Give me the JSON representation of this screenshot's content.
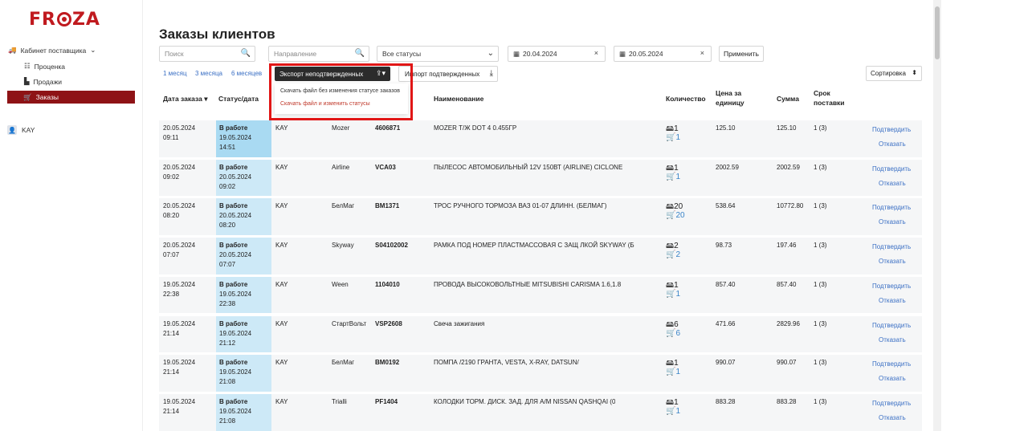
{
  "logo": "FROZA",
  "sidebar": {
    "cabinet_label": "Кабинет поставщика",
    "items": [
      {
        "label": "Проценка"
      },
      {
        "label": "Продажи"
      },
      {
        "label": "Заказы"
      }
    ],
    "user": "KAY"
  },
  "page": {
    "title": "Заказы клиентов"
  },
  "filters": {
    "search_placeholder": "Поиск",
    "direction_placeholder": "Направление",
    "status_value": "Все статусы",
    "date_from": "20.04.2024",
    "date_to": "20.05.2024",
    "apply_label": "Применить"
  },
  "periods": [
    "1 месяц",
    "3 месяца",
    "6 месяцев"
  ],
  "export_label": "Экспорт неподтвержденных",
  "import_label": "Импорт подтвержденных",
  "export_menu": {
    "item1": "Скачать файл без изменения статусе заказов",
    "item2": "Скачать файл и изменить статусы"
  },
  "sort_label": "Сортировка",
  "table": {
    "headers": {
      "date": "Дата заказа",
      "status": "Статус/дата",
      "name": "Наименование",
      "qty": "Количество",
      "price": "Цена за единицу",
      "sum": "Сумма",
      "term": "Срок поставки"
    },
    "confirm_label": "Подтвердить",
    "reject_label": "Отказать",
    "rows": [
      {
        "date": "20.05.2024",
        "time": "09:11",
        "status": "В работе",
        "sdate": "19.05.2024",
        "stime": "14:51",
        "client": "KAY",
        "brand": "Mozer",
        "article": "4606871",
        "name": "MOZER Т/Ж DOT 4 0.455ГР",
        "qty": "1",
        "qty2": "1",
        "price": "125.10",
        "sum": "125.10",
        "term": "1 (3)"
      },
      {
        "date": "20.05.2024",
        "time": "09:02",
        "status": "В работе",
        "sdate": "20.05.2024",
        "stime": "09:02",
        "client": "KAY",
        "brand": "Airline",
        "article": "VCA03",
        "name": "ПЫЛЕСОС АВТОМОБИЛЬНЫЙ 12V 150ВТ (AIRLINE) CICLONE",
        "qty": "1",
        "qty2": "1",
        "price": "2002.59",
        "sum": "2002.59",
        "term": "1 (3)"
      },
      {
        "date": "20.05.2024",
        "time": "08:20",
        "status": "В работе",
        "sdate": "20.05.2024",
        "stime": "08:20",
        "client": "KAY",
        "brand": "БелМаг",
        "article": "BM1371",
        "name": "ТРОС РУЧНОГО ТОРМОЗА ВАЗ 01-07 ДЛИНН. (БЕЛМАГ)",
        "qty": "20",
        "qty2": "20",
        "price": "538.64",
        "sum": "10772.80",
        "term": "1 (3)"
      },
      {
        "date": "20.05.2024",
        "time": "07:07",
        "status": "В работе",
        "sdate": "20.05.2024",
        "stime": "07:07",
        "client": "KAY",
        "brand": "Skyway",
        "article": "S04102002",
        "name": "РАМКА ПОД НОМЕР ПЛАСТМАССОВАЯ С ЗАЩ ЛКОЙ SKYWAY (Б",
        "qty": "2",
        "qty2": "2",
        "price": "98.73",
        "sum": "197.46",
        "term": "1 (3)"
      },
      {
        "date": "19.05.2024",
        "time": "22:38",
        "status": "В работе",
        "sdate": "19.05.2024",
        "stime": "22:38",
        "client": "KAY",
        "brand": "Ween",
        "article": "1104010",
        "name": "ПРОВОДА ВЫСОКОВОЛЬТНЫЕ MITSUBISHI CARISMA 1.6,1.8",
        "qty": "1",
        "qty2": "1",
        "price": "857.40",
        "sum": "857.40",
        "term": "1 (3)"
      },
      {
        "date": "19.05.2024",
        "time": "21:14",
        "status": "В работе",
        "sdate": "19.05.2024",
        "stime": "21:12",
        "client": "KAY",
        "brand": "СтартВольт",
        "article": "VSP2608",
        "name": "Свеча зажигания",
        "qty": "6",
        "qty2": "6",
        "price": "471.66",
        "sum": "2829.96",
        "term": "1 (3)"
      },
      {
        "date": "19.05.2024",
        "time": "21:14",
        "status": "В работе",
        "sdate": "19.05.2024",
        "stime": "21:08",
        "client": "KAY",
        "brand": "БелМаг",
        "article": "BM0192",
        "name": "ПОМПА /2190 ГРАНТА, VESTA, X-RAY, DATSUN/",
        "qty": "1",
        "qty2": "1",
        "price": "990.07",
        "sum": "990.07",
        "term": "1 (3)"
      },
      {
        "date": "19.05.2024",
        "time": "21:14",
        "status": "В работе",
        "sdate": "19.05.2024",
        "stime": "21:08",
        "client": "KAY",
        "brand": "Trialli",
        "article": "PF1404",
        "name": "КОЛОДКИ ТОРМ. ДИСК. ЗАД. ДЛЯ А/М NISSAN QASHQAI (0",
        "qty": "1",
        "qty2": "1",
        "price": "883.28",
        "sum": "883.28",
        "term": "1 (3)"
      }
    ]
  },
  "colors": {
    "brand": "#c01a1f",
    "active_nav": "#8e1316",
    "highlight": "#e11616",
    "link": "#3a6fc4"
  }
}
